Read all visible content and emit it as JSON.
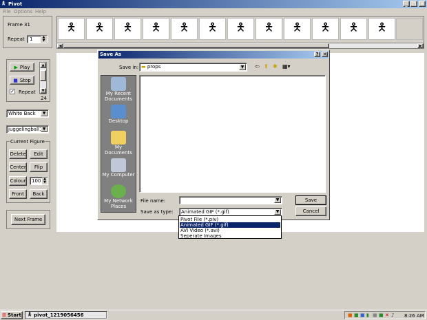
{
  "app": {
    "title": "Pivot",
    "menu": [
      "File",
      "Options",
      "Help"
    ],
    "frame_label": "Frame 31",
    "repeat_label": "Repeat",
    "repeat_value": "1",
    "play": "Play",
    "stop": "Stop",
    "repeat_check": "Repeat",
    "speed": "24",
    "background_select": "White Back",
    "figure_select": "juggelingball1",
    "current_figure": "Current Figure",
    "delete": "Delete",
    "edit": "Edit",
    "center": "Center",
    "flip": "Flip",
    "colour": "Colour",
    "colour_value": "100",
    "front": "Front",
    "back": "Back",
    "next_frame": "Next Frame",
    "frame_figure_glyph": "🯅"
  },
  "dialog": {
    "title": "Save As",
    "save_in_label": "Save in:",
    "save_in_value": "props",
    "places": [
      "My Recent Documents",
      "Desktop",
      "My Documents",
      "My Computer",
      "My Network Places"
    ],
    "file_name_label": "File name:",
    "file_name_value": "",
    "save_as_type_label": "Save as type:",
    "save_as_type_value": "Animated GIF (*.gif)",
    "type_options": [
      "Pivot File (*.piv)",
      "Animated GIF (*.gif)",
      "AVI Video (*.avi)",
      "Seperate Images"
    ],
    "save_button": "Save",
    "cancel_button": "Cancel"
  },
  "taskbar": {
    "start": "Start",
    "task": "pivot_1219056456",
    "clock": "8:26 AM"
  }
}
